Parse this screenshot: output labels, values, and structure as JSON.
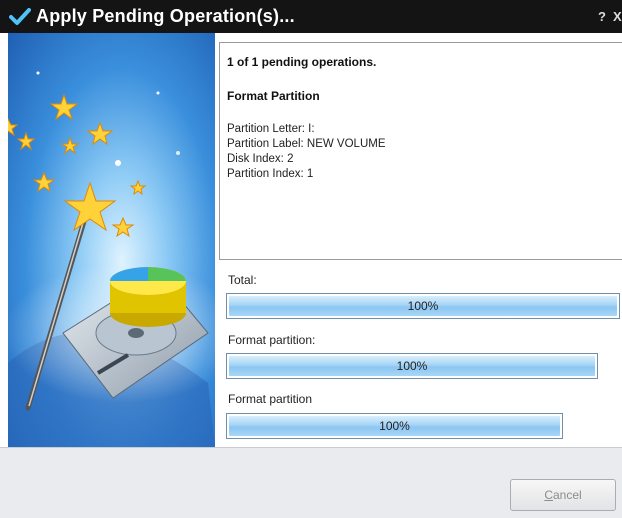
{
  "window": {
    "title": "Apply Pending Operation(s)...",
    "help_label": "?",
    "close_label": "X"
  },
  "details": {
    "count_text": "1 of 1 pending operations.",
    "operation_title": "Format Partition",
    "lines": [
      "Partition Letter: I:",
      "Partition Label: NEW VOLUME",
      "Disk Index: 2",
      "Partition Index: 1"
    ]
  },
  "progress": [
    {
      "label": "Total:",
      "text": "100%",
      "value": 1.0
    },
    {
      "label": "Format partition:",
      "text": "100%",
      "value": 1.0
    },
    {
      "label": "Format partition",
      "text": "100%",
      "value": 1.0
    }
  ],
  "footer": {
    "cancel_prefix": "",
    "cancel_mnemonic": "C",
    "cancel_rest": "ancel"
  },
  "colors": {
    "titlebar": "#141414",
    "accent_blue": "#8cc6f2",
    "check_green": "#4fc3f7"
  }
}
